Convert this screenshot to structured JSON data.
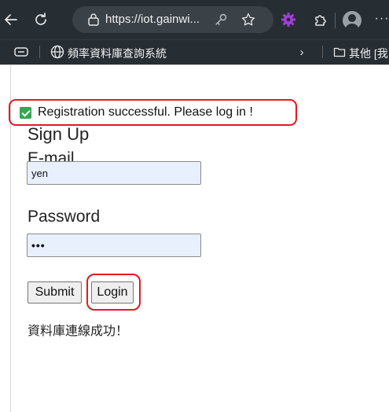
{
  "browser": {
    "url": "https://iot.gainwi...",
    "bookmarks": {
      "item_label": "頻率資料庫查詢系統",
      "other_label": "其他 [我"
    },
    "icons": {
      "back": "arrow-left",
      "reload": "refresh",
      "lock": "site-info",
      "key": "password-key",
      "star": "favorite-star",
      "extension1": "purple-gear",
      "extension2": "extensions-puzzle",
      "profile": "user-avatar",
      "more": "ellipsis"
    }
  },
  "notice": {
    "text": "Registration successful. Please log in !",
    "accent_color": "#33a853",
    "highlight_color": "#e8161f"
  },
  "form": {
    "title": "Sign Up",
    "email_label": "E-mail",
    "email_value": "yen",
    "password_label": "Password",
    "password_value": "•••",
    "submit_label": "Submit",
    "login_label": "Login",
    "input_bg": "#e8f0fe"
  },
  "status": {
    "db_message": "資料庫連線成功！"
  }
}
